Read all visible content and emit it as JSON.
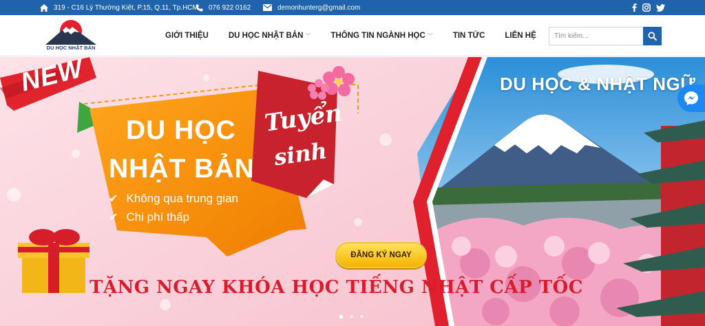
{
  "topbar": {
    "address": "319 - C16 Lý Thường Kiệt, P.15, Q.11, Tp.HCM",
    "phone": "076 922 0162",
    "email": "demonhunterg@gmail.com",
    "social": [
      "facebook-icon",
      "instagram-icon",
      "twitter-icon"
    ]
  },
  "header": {
    "logo_text": "DU HỌC NHẬT BẢN",
    "nav": [
      {
        "label": "GIỚI THIỆU"
      },
      {
        "label": "DU HỌC NHẬT BẢN",
        "dropdown": true
      },
      {
        "label": "THÔNG TIN NGÀNH HỌC",
        "dropdown": true
      },
      {
        "label": "TIN TỨC"
      },
      {
        "label": "LIÊN HỆ"
      }
    ],
    "search_placeholder": "Tìm kiếm..."
  },
  "hero": {
    "new_label": "NEW",
    "title_line1": "DU HỌC",
    "title_line2": "NHẬT BẢN",
    "badge_line1": "Tuyển",
    "badge_line2": "sinh",
    "bullets": [
      "Không qua trung gian",
      "Chi phí thấp"
    ],
    "cta_label": "ĐĂNG KÝ NGAY",
    "promo_text": "TẶNG NGAY KHÓA HỌC TIẾNG NHẬT CẤP TỐC",
    "right_title": "DU HỌC & NHẬT NGỮ",
    "slide_count": 3,
    "active_slide": 0
  },
  "colors": {
    "brand_blue": "#1f63ad",
    "accent_orange": "#f59a0c",
    "accent_red": "#c8232c",
    "cta_yellow": "#ffd23a",
    "pink_bg": "#fbd3dc",
    "messenger_blue": "#1e88f2"
  }
}
